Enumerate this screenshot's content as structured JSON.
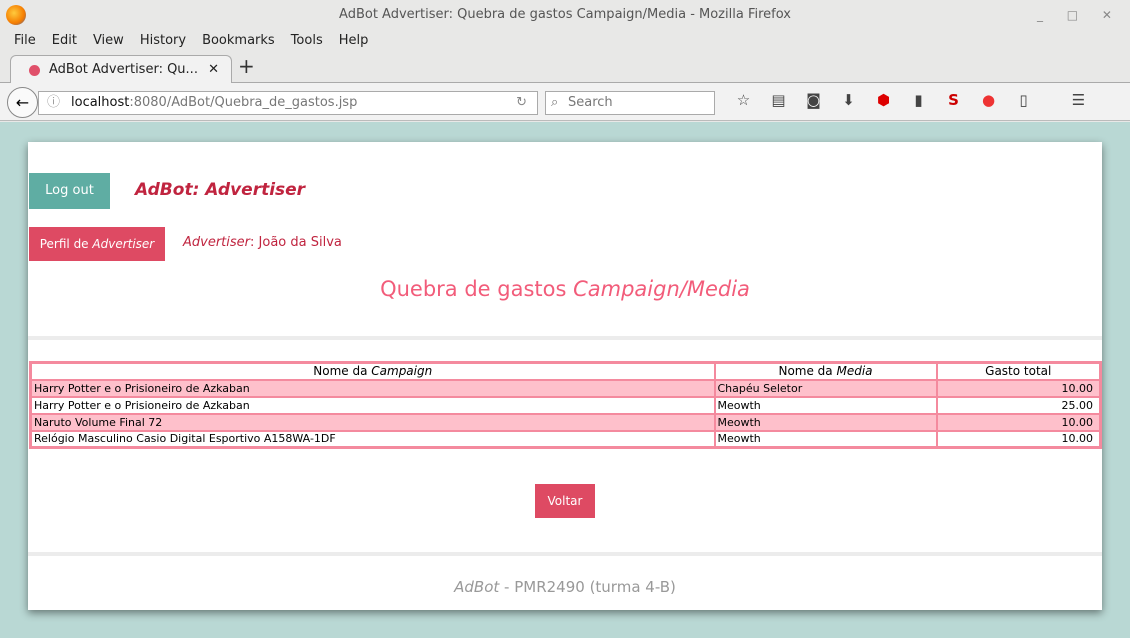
{
  "window": {
    "title": "AdBot Advertiser: Quebra de gastos Campaign/Media - Mozilla Firefox",
    "controls": "_ □ ✕"
  },
  "menu": [
    "File",
    "Edit",
    "View",
    "History",
    "Bookmarks",
    "Tools",
    "Help"
  ],
  "tab": {
    "label": "AdBot Advertiser: Qu...",
    "close": "✕",
    "new": "+"
  },
  "nav": {
    "url_host": "localhost",
    "url_rest": ":8080/AdBot/Quebra_de_gastos.jsp",
    "search_placeholder": "Search"
  },
  "toolbar_icons": [
    "star-icon",
    "reading-list-icon",
    "pocket-icon",
    "download-icon",
    "adblock-icon",
    "extension-icon",
    "s-extension-icon",
    "color-extension-icon",
    "clipboard-icon",
    "menu-icon"
  ],
  "header": {
    "logout": "Log out",
    "brand": "AdBot: Advertiser",
    "perfil_prefix": "Perfil de ",
    "perfil_em": "Advertiser",
    "advertiser_label": "Advertiser",
    "advertiser_name": ": João da Silva"
  },
  "title": {
    "main": "Quebra de gastos ",
    "em": "Campaign/Media"
  },
  "table": {
    "headers": [
      {
        "prefix": "Nome da ",
        "em": "Campaign"
      },
      {
        "prefix": "Nome da ",
        "em": "Media"
      },
      {
        "prefix": "Gasto total",
        "em": ""
      }
    ],
    "rows": [
      [
        "Harry Potter e o Prisioneiro de Azkaban",
        "Chapéu Seletor",
        "10.00"
      ],
      [
        "Harry Potter e o Prisioneiro de Azkaban",
        "Meowth",
        "25.00"
      ],
      [
        "Naruto Volume Final 72",
        "Meowth",
        "10.00"
      ],
      [
        "Relógio Masculino Casio Digital Esportivo A158WA-1DF",
        "Meowth",
        "10.00"
      ]
    ]
  },
  "voltar": "Voltar",
  "footer": {
    "em": "AdBot",
    "rest": " - PMR2490 (turma 4-B)"
  }
}
